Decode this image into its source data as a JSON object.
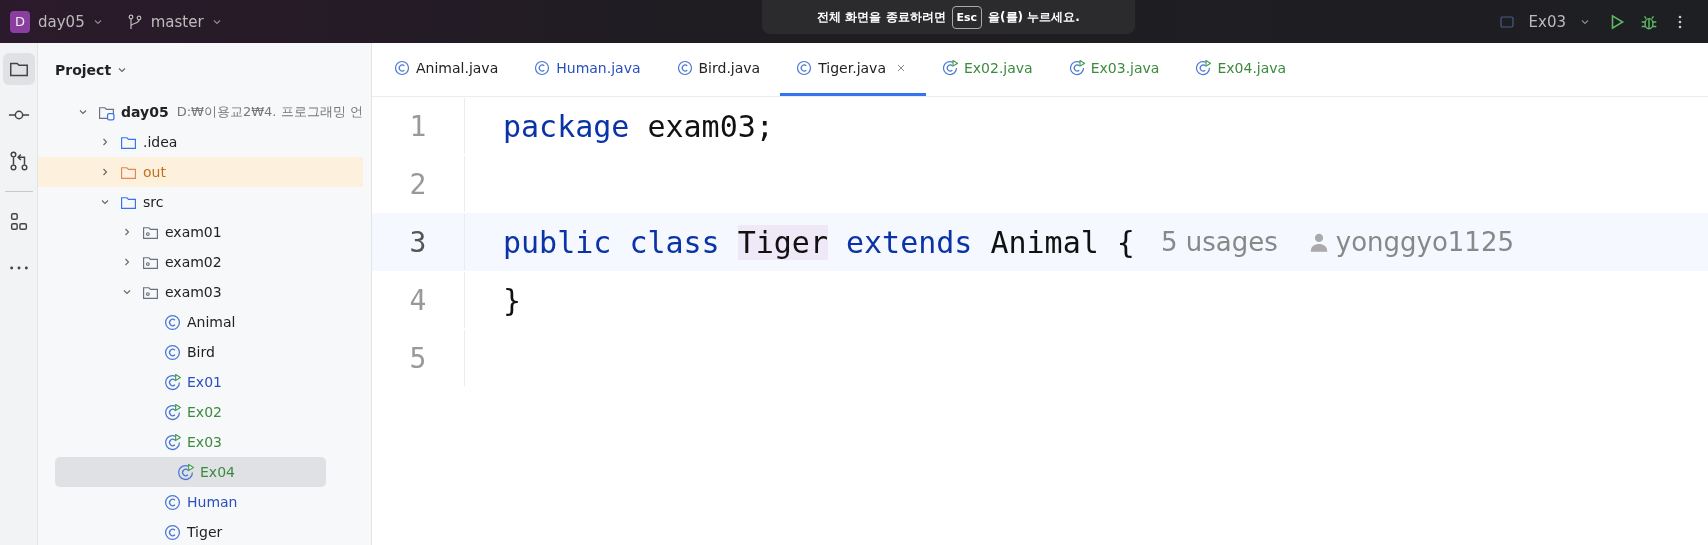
{
  "titlebar": {
    "project_badge": "D",
    "project": "day05",
    "branch": "master",
    "run_config": "Ex03"
  },
  "toast": {
    "before": "전체 화면을 종료하려면",
    "key": "Esc",
    "after": "을(를) 누르세요."
  },
  "project_panel": {
    "title": "Project",
    "tree": [
      {
        "kind": "module",
        "label": "day05",
        "path": "D:₩이용교2₩4. 프로그래밍 언",
        "expanded": true,
        "selected": false,
        "excluded": false,
        "children": [
          {
            "kind": "folder",
            "label": ".idea",
            "expanded": false,
            "selected": false,
            "excluded": false
          },
          {
            "kind": "folder",
            "label": "out",
            "expanded": false,
            "selected": false,
            "excluded": true
          },
          {
            "kind": "folder",
            "label": "src",
            "expanded": true,
            "selected": false,
            "excluded": false,
            "children": [
              {
                "kind": "package",
                "label": "exam01",
                "expanded": false,
                "selected": false,
                "excluded": false
              },
              {
                "kind": "package",
                "label": "exam02",
                "expanded": false,
                "selected": false,
                "excluded": false
              },
              {
                "kind": "package",
                "label": "exam03",
                "expanded": true,
                "selected": false,
                "excluded": false,
                "children": [
                  {
                    "kind": "class",
                    "label": "Animal",
                    "color": "#222222",
                    "selected": false,
                    "excluded": false
                  },
                  {
                    "kind": "class",
                    "label": "Bird",
                    "color": "#222222",
                    "selected": false,
                    "excluded": false
                  },
                  {
                    "kind": "runnable",
                    "label": "Ex01",
                    "color": "#2a4fbf",
                    "selected": false,
                    "excluded": false
                  },
                  {
                    "kind": "runnable",
                    "label": "Ex02",
                    "color": "#3b8a3e",
                    "selected": false,
                    "excluded": false
                  },
                  {
                    "kind": "runnable",
                    "label": "Ex03",
                    "color": "#3b8a3e",
                    "selected": false,
                    "excluded": false
                  },
                  {
                    "kind": "runnable",
                    "label": "Ex04",
                    "color": "#3b8a3e",
                    "selected": true,
                    "excluded": false
                  },
                  {
                    "kind": "class",
                    "label": "Human",
                    "color": "#2a4fbf",
                    "selected": false,
                    "excluded": false
                  },
                  {
                    "kind": "class",
                    "label": "Tiger",
                    "color": "#222222",
                    "selected": false,
                    "excluded": false
                  }
                ]
              }
            ]
          }
        ]
      }
    ]
  },
  "tabs": [
    {
      "label": "Animal.java",
      "kind": "class",
      "color": "#222222",
      "selected": false
    },
    {
      "label": "Human.java",
      "kind": "class",
      "color": "#2a4fbf",
      "selected": false
    },
    {
      "label": "Bird.java",
      "kind": "class",
      "color": "#222222",
      "selected": false
    },
    {
      "label": "Tiger.java",
      "kind": "class",
      "color": "#222222",
      "selected": true
    },
    {
      "label": "Ex02.java",
      "kind": "runnable",
      "color": "#3b8a3e",
      "selected": false
    },
    {
      "label": "Ex03.java",
      "kind": "runnable",
      "color": "#3b8a3e",
      "selected": false
    },
    {
      "label": "Ex04.java",
      "kind": "runnable",
      "color": "#3b8a3e",
      "selected": false
    }
  ],
  "editor": {
    "lines": [
      {
        "number": "1",
        "current": false,
        "tokens": [
          {
            "kind": "keyword",
            "text": "package"
          },
          {
            "kind": "plain",
            "text": "exam03;"
          }
        ]
      },
      {
        "number": "2",
        "current": false
      },
      {
        "number": "3",
        "current": true,
        "tokens": [
          {
            "kind": "keyword",
            "text": "public"
          },
          {
            "kind": "keyword",
            "text": "class"
          },
          {
            "kind": "highlight",
            "text": "Tiger"
          },
          {
            "kind": "keyword",
            "text": "extends"
          },
          {
            "kind": "plain",
            "text": "Animal {"
          }
        ],
        "usages": "5 usages",
        "author": "yonggyo1125"
      },
      {
        "number": "4",
        "current": false,
        "tokens": [
          {
            "kind": "plain",
            "text": "}"
          }
        ]
      },
      {
        "number": "5",
        "current": false
      }
    ]
  }
}
